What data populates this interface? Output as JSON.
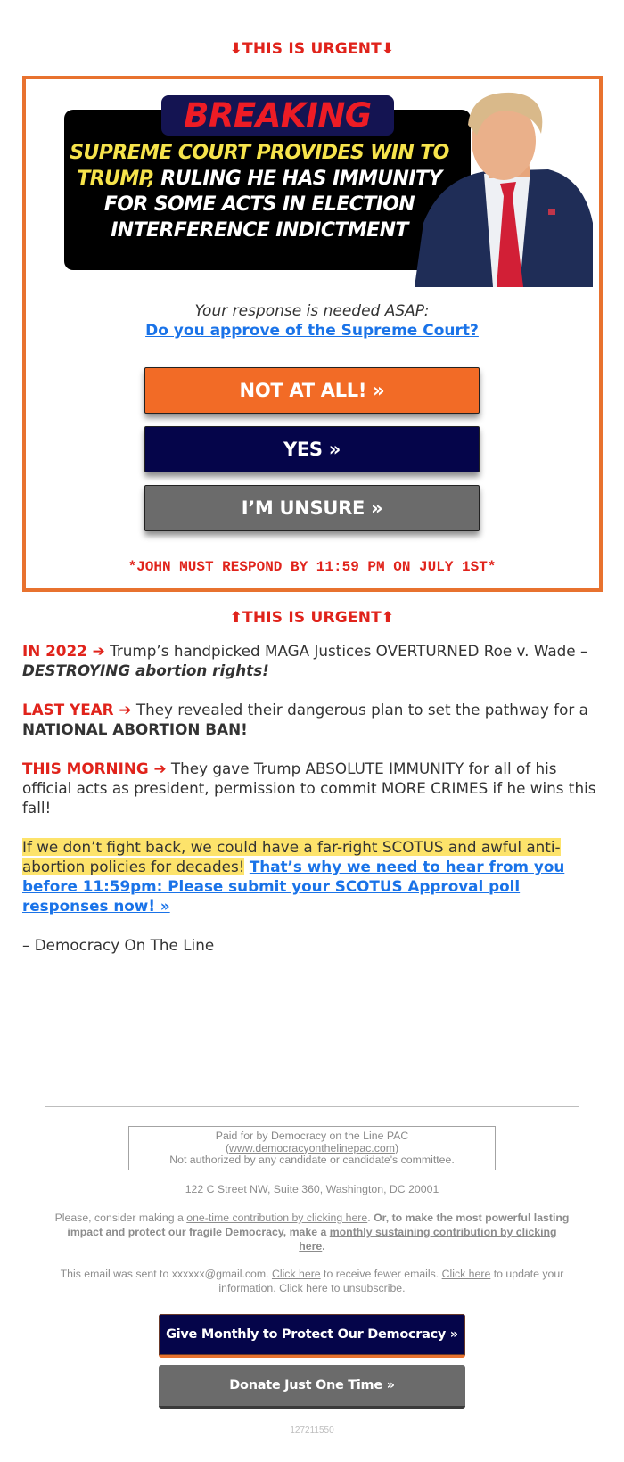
{
  "urgent_top": "⬇THIS IS URGENT⬇",
  "urgent_bottom": "⬆THIS IS URGENT⬆",
  "graphic": {
    "badge": "BREAKING",
    "headline_yellow_1": "SUPREME COURT PROVIDES WIN TO",
    "headline_yellow_2": "TRUMP,",
    "headline_white_2": " RULING HE HAS IMMUNITY",
    "headline_white_3": "FOR SOME ACTS IN ELECTION",
    "headline_white_4": "INTERFERENCE INDICTMENT",
    "portrait_alt": "Donald Trump portrait"
  },
  "poll": {
    "prompt": "Your response is needed ASAP:",
    "question": "Do you approve of the Supreme Court?",
    "options": [
      {
        "label": "NOT AT ALL! »",
        "color": "#f26b26"
      },
      {
        "label": "YES »",
        "color": "#05054a"
      },
      {
        "label": "I’M UNSURE »",
        "color": "#6b6b6b"
      }
    ],
    "deadline": "*JOHN MUST RESPOND BY 11:59 PM ON JULY 1ST*"
  },
  "body": {
    "p1_lead": "IN 2022 ➔",
    "p1_text": " Trump’s handpicked MAGA Justices OVERTURNED Roe v. Wade – ",
    "p1_emph": "DESTROYING abortion rights!",
    "p2_lead": "LAST YEAR ➔",
    "p2_text": " They revealed their dangerous plan to set the pathway for a ",
    "p2_bold": "NATIONAL ABORTION BAN!",
    "p3_lead": "THIS MORNING ➔",
    "p3_text": " They gave Trump ABSOLUTE IMMUNITY for all of his official acts as president, permission to commit MORE CRIMES if he wins this fall!",
    "p4_highlight": "If we don’t fight back, we could have a far-right SCOTUS and awful anti-abortion policies for decades!",
    "p4_link": "That’s why we need to hear from you before 11:59pm: Please submit your SCOTUS Approval poll responses now! »",
    "signature": "– Democracy On The Line"
  },
  "footer": {
    "paid_line1": "Paid for by Democracy on the Line PAC",
    "paid_link": "www.democracyonthelinepac.com",
    "paid_line3": "Not authorized by any candidate or candidate's committee.",
    "address": "122 C Street NW, Suite 360, Washington, DC 20001",
    "contrib_pre": "Please, consider making a ",
    "contrib_link1": "one-time contribution by clicking here",
    "contrib_mid": ". ",
    "contrib_bold": "Or, to make the most powerful lasting impact and protect our fragile Democracy, make a ",
    "contrib_link2": "monthly sustaining contribution by clicking here",
    "contrib_end": ".",
    "email_pre": "This email was sent to xxxxxx@gmail.com. ",
    "email_link1": "Click here",
    "email_mid": " to receive fewer emails. ",
    "email_link2": "Click here",
    "email_post": " to update your information. Click here to unsubscribe.",
    "btn_monthly": "Give Monthly to Protect Our Democracy »",
    "btn_once": "Donate Just One Time »",
    "ref_id": "127211550"
  },
  "colors": {
    "accent_orange": "#e8722f",
    "urgent_red": "#e0231b",
    "navy": "#05054a",
    "gray_button": "#6b6b6b",
    "link_blue": "#1a73e8",
    "highlight_yellow": "#fde36b"
  }
}
